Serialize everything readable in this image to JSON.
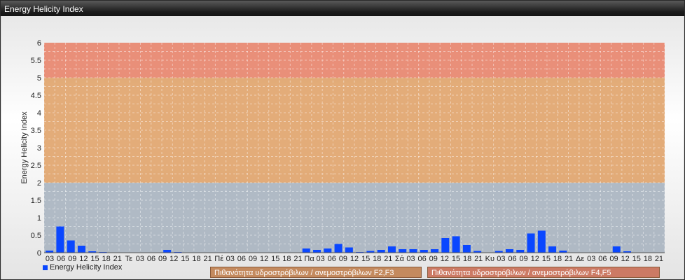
{
  "window": {
    "title": "Energy Helicity Index"
  },
  "chart_data": {
    "type": "bar",
    "ylabel": "Energy Helicity Index",
    "ylim": [
      0,
      6
    ],
    "yticks": [
      "0",
      "0.5",
      "1",
      "1.5",
      "2",
      "2.5",
      "3",
      "3.5",
      "4",
      "4.5",
      "5",
      "5.5",
      "6"
    ],
    "grid": true,
    "series": [
      {
        "name": "Energy Helicity Index",
        "color": "#0a47ff",
        "values": [
          0.06,
          0.75,
          0.35,
          0.2,
          0.04,
          0.02,
          0.01,
          0.01,
          0.01,
          0.01,
          0.01,
          0.08,
          0.02,
          0.01,
          0.01,
          0.01,
          0.01,
          0.01,
          0.01,
          0.01,
          0.01,
          0.01,
          0.01,
          0.01,
          0.12,
          0.08,
          0.12,
          0.25,
          0.15,
          0.02,
          0.05,
          0.08,
          0.18,
          0.1,
          0.1,
          0.08,
          0.1,
          0.42,
          0.47,
          0.22,
          0.05,
          0.01,
          0.05,
          0.1,
          0.08,
          0.55,
          0.63,
          0.18,
          0.06,
          0.01,
          0.01,
          0.01,
          0.01,
          0.18,
          0.04,
          0.01,
          0.01,
          0.01
        ]
      }
    ],
    "categories": [
      "03",
      "06",
      "09",
      "12",
      "15",
      "18",
      "21",
      "Τε",
      "03",
      "06",
      "09",
      "12",
      "15",
      "18",
      "21",
      "Πέ",
      "03",
      "06",
      "09",
      "12",
      "15",
      "18",
      "21",
      "Πα",
      "03",
      "06",
      "09",
      "12",
      "15",
      "18",
      "21",
      "Σά",
      "03",
      "06",
      "09",
      "12",
      "15",
      "18",
      "21",
      "Κυ",
      "03",
      "06",
      "09",
      "12",
      "15",
      "18",
      "21",
      "Δε",
      "03",
      "06",
      "09",
      "12",
      "15",
      "18",
      "21"
    ],
    "tick_labels": [
      "03",
      "06",
      "09",
      "12",
      "15",
      "18",
      "21",
      "Τε",
      "03",
      "06",
      "09",
      "12",
      "15",
      "18",
      "21",
      "Πέ",
      "03",
      "06",
      "09",
      "12",
      "15",
      "18",
      "21",
      "Πα",
      "03",
      "06",
      "09",
      "12",
      "15",
      "18",
      "21",
      "Σά",
      "03",
      "06",
      "09",
      "12",
      "15",
      "18",
      "21",
      "Κυ",
      "03",
      "06",
      "09",
      "12",
      "15",
      "18",
      "21",
      "Δε",
      "03",
      "06",
      "09",
      "12",
      "15",
      "18",
      "21"
    ],
    "bands": [
      {
        "from": 0,
        "to": 2,
        "color": "#a8b4c0"
      },
      {
        "from": 2,
        "to": 5,
        "color": "#e0a36a",
        "label": "Πιθανότητα υδροστρόβιλων / ανεμοστρόβιλων F2,F3"
      },
      {
        "from": 5,
        "to": 6,
        "color": "#e8846c",
        "label": "Πιθανότητα υδροστρόβιλων / ανεμοστρόβιλων F4,F5"
      }
    ]
  },
  "legend": {
    "series_label": "Energy Helicity Index"
  }
}
